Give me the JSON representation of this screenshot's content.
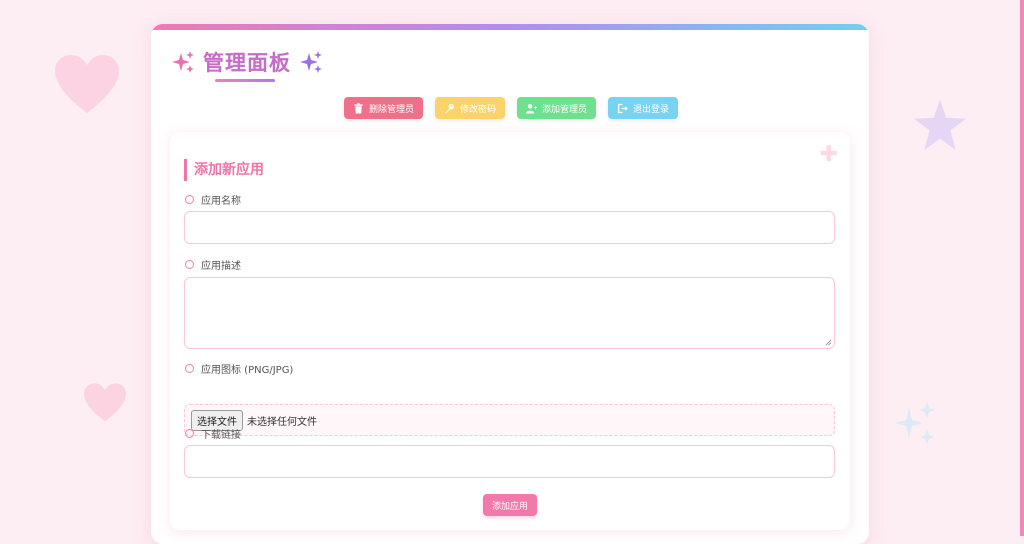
{
  "header": {
    "title": "管理面板",
    "title_icon": "sparkles-icon"
  },
  "toolbar": {
    "buttons": [
      {
        "label": "删除管理员",
        "icon": "trash-icon",
        "color": "#f0708a"
      },
      {
        "label": "修改密码",
        "icon": "key-icon",
        "color": "#fcd36a"
      },
      {
        "label": "添加管理员",
        "icon": "user-plus-icon",
        "color": "#6fe08e"
      },
      {
        "label": "退出登录",
        "icon": "sign-out-icon",
        "color": "#78d2f2"
      }
    ]
  },
  "form": {
    "section_title": "添加新应用",
    "fields": {
      "name": {
        "label": "应用名称",
        "value": ""
      },
      "description": {
        "label": "应用描述",
        "value": ""
      },
      "icon": {
        "label": "应用图标 (PNG/JPG)",
        "choose_label": "选择文件",
        "status": "未选择任何文件"
      },
      "download": {
        "label": "下载链接",
        "value": ""
      }
    },
    "submit_label": "添加应用"
  },
  "theme": {
    "accent": "#f074a8",
    "background": "#fdeef3",
    "gradient": [
      "#f079b4",
      "#b38cf2",
      "#6fd0f2"
    ]
  }
}
